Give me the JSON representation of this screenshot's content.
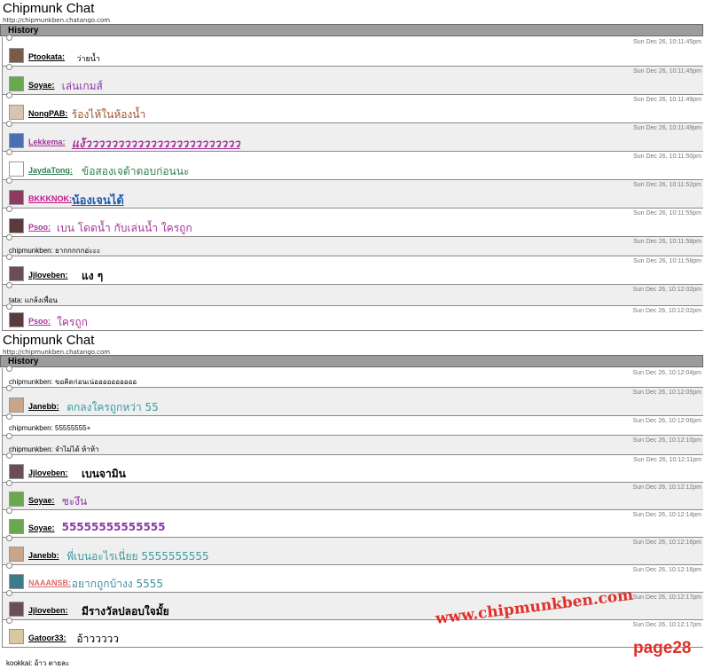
{
  "colors": {
    "history_bar": "#9c9c9c",
    "alt_row": "#efefef",
    "watermark": "#e0302a"
  },
  "panel1": {
    "title": "Chipmunk Chat",
    "url": "http://chipmunkben.chatango.com",
    "history_label": "History",
    "messages": [
      {
        "kind": "user",
        "user": "Ptookata",
        "text": "ว่ายน้ำ",
        "ts": "Sun Dec 26, 10:11:45pm"
      },
      {
        "kind": "user",
        "user": "Soyae",
        "text": "เล่นเกมส์",
        "ts": "Sun Dec 26, 10:11:45pm"
      },
      {
        "kind": "user",
        "user": "NongPAB",
        "text": "ร้องไห้ในห้องน้ำ",
        "ts": "Sun Dec 26, 10:11:49pm"
      },
      {
        "kind": "user",
        "user": "Lekkema",
        "text": "แง้วววววววววววววววววววววววว",
        "ts": "Sun Dec 26, 10:11:49pm"
      },
      {
        "kind": "user",
        "user": "JaydaTong",
        "text": "ข้อสองเจต้าตอบก่อนนะ",
        "ts": "Sun Dec 26, 10:11:50pm"
      },
      {
        "kind": "user",
        "user": "BKKKNOK",
        "text": "น้องเจนได้",
        "ts": "Sun Dec 26, 10:11:52pm"
      },
      {
        "kind": "user",
        "user": "Psoo",
        "text": "เบน โดดน้ำ กับเล่นน้ำ ใครถูก",
        "ts": "Sun Dec 26, 10:11:55pm"
      },
      {
        "kind": "plain",
        "text": "chipmunkben: ยากกกกกอ่ะะะ",
        "ts": "Sun Dec 26, 10:11:58pm"
      },
      {
        "kind": "user",
        "user": "Jjloveben",
        "text": "แง ๆ",
        "ts": "Sun Dec 26, 10:11:58pm"
      },
      {
        "kind": "plain",
        "text": "tata: แกล้งเพื่อน",
        "ts": "Sun Dec 26, 10:12:02pm"
      },
      {
        "kind": "user",
        "user": "Psoo",
        "text": "ใครถูก",
        "ts": "Sun Dec 26, 10:12:02pm"
      }
    ]
  },
  "panel2": {
    "title": "Chipmunk Chat",
    "url": "http://chipmunkben.chatango.com",
    "history_label": "History",
    "messages": [
      {
        "kind": "plain",
        "text": "chipmunkben: ขอคิดก่อนเน่ออออออออออ",
        "ts": "Sun Dec 26, 10:12:04pm"
      },
      {
        "kind": "user",
        "user": "Janebb",
        "text": "ตกลงใครถูกหว่า 55",
        "ts": "Sun Dec 26, 10:12:05pm"
      },
      {
        "kind": "plain",
        "text": "chipmunkben: 55555555+",
        "ts": "Sun Dec 26, 10:12:06pm"
      },
      {
        "kind": "plain",
        "text": "chipmunkben: จำไม่ได้ ห้าห้า",
        "ts": "Sun Dec 26, 10:12:10pm"
      },
      {
        "kind": "user",
        "user": "Jjloveben",
        "text": "เบนจามิน",
        "ts": "Sun Dec 26, 10:12:11pm"
      },
      {
        "kind": "user",
        "user": "Soyae",
        "text": "ชะงึน",
        "ts": "Sun Dec 26, 10:12:12pm"
      },
      {
        "kind": "user",
        "user": "Soyae",
        "text": "55555555555555",
        "ts": "Sun Dec 26, 10:12:14pm"
      },
      {
        "kind": "user",
        "user": "Janebb",
        "text": "พี่เบนอะไรเนี่ยย 5555555555",
        "ts": "Sun Dec 26, 10:12:16pm"
      },
      {
        "kind": "user",
        "user": "NAAANSB",
        "text": "อยากถูกบ้างง 5555",
        "ts": "Sun Dec 26, 10:12:16pm"
      },
      {
        "kind": "user",
        "user": "Jjloveben",
        "text": "มีรางวัลปลอบใจมั้ย",
        "ts": "Sun Dec 26, 10:12:17pm"
      },
      {
        "kind": "user",
        "user": "Gatoor33",
        "text": "อ้าววววว",
        "ts": "Sun Dec 26, 10:12:17pm"
      }
    ]
  },
  "footer_line": "kookkai: อ้าว ตายละ",
  "watermark": "www.chipmunkben.com",
  "page_label": "page28"
}
